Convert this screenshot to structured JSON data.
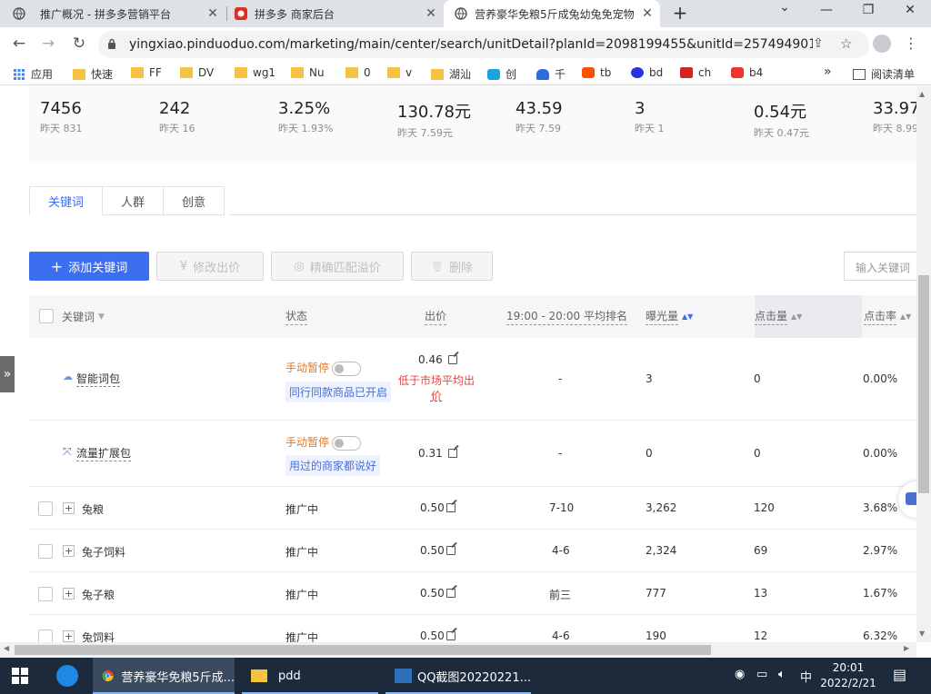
{
  "browser": {
    "tabs": [
      {
        "title": "推广概况 - 拼多多营销平台",
        "close": "✕"
      },
      {
        "title": "拼多多 商家后台",
        "close": "✕"
      },
      {
        "title": "营养豪华免粮5斤成兔幼兔免宠物兔",
        "close": "✕"
      }
    ],
    "new_tab": "+",
    "window_controls": {
      "dropdown": "⌄",
      "minimize": "—",
      "restore": "❐",
      "close": "✕"
    },
    "url": "yingxiao.pinduoduo.com/marketing/main/center/search/unitDetail?planId=2098199455&unitId=257494901...",
    "bookmarks": [
      "应用",
      "快速",
      "FF",
      "DV",
      "wg1",
      "Nu",
      "0",
      "v",
      "湖汕",
      "创",
      "千",
      "tb",
      "bd",
      "ch",
      "b4"
    ],
    "more": "»",
    "reading_list": "阅读清单"
  },
  "metrics": [
    {
      "value": "7456",
      "yesterday": "昨天 831"
    },
    {
      "value": "242",
      "yesterday": "昨天 16"
    },
    {
      "value": "3.25%",
      "yesterday": "昨天 1.93%"
    },
    {
      "value": "130.78元",
      "yesterday": "昨天 7.59元"
    },
    {
      "value": "43.59",
      "yesterday": "昨天 7.59"
    },
    {
      "value": "3",
      "yesterday": "昨天 1"
    },
    {
      "value": "0.54元",
      "yesterday": "昨天 0.47元"
    },
    {
      "value": "33.97",
      "yesterday": "昨天 8.99"
    }
  ],
  "tabs": [
    "关键词",
    "人群",
    "创意"
  ],
  "actions": {
    "add": "添加关键词",
    "add_icon": "+",
    "modify_bid": "修改出价",
    "modify_icon": "¥",
    "precise_premium": "精确匹配溢价",
    "precise_icon": "◎",
    "delete": "删除",
    "delete_icon": "🗑",
    "search_placeholder": "输入关键词"
  },
  "table": {
    "headers": {
      "keyword": "关键词",
      "filter_icon": "▼",
      "status": "状态",
      "bid": "出价",
      "rank": "19:00 - 20:00 平均排名",
      "impressions": "曝光量",
      "clicks": "点击量",
      "ctr": "点击率",
      "sort_icon": "▲▼"
    },
    "packages": [
      {
        "icon": "☁",
        "name": "智能词包",
        "status": "手动暂停",
        "tag": "同行同款商品已开启",
        "bid": "0.46",
        "warning": [
          "低于市场平均出",
          "价"
        ],
        "rank": "-",
        "impressions": "3",
        "clicks": "0",
        "ctr": "0.00%"
      },
      {
        "icon": "⤧",
        "name": "流量扩展包",
        "status": "手动暂停",
        "tag": "用过的商家都说好",
        "bid": "0.31",
        "rank": "-",
        "impressions": "0",
        "clicks": "0",
        "ctr": "0.00%"
      }
    ],
    "rows": [
      {
        "expand": "+",
        "name": "兔粮",
        "status": "推广中",
        "bid": "0.50",
        "rank": "7-10",
        "impressions": "3,262",
        "clicks": "120",
        "ctr": "3.68%"
      },
      {
        "expand": "+",
        "name": "兔子饲料",
        "status": "推广中",
        "bid": "0.50",
        "rank": "4-6",
        "impressions": "2,324",
        "clicks": "69",
        "ctr": "2.97%"
      },
      {
        "expand": "+",
        "name": "兔子粮",
        "status": "推广中",
        "bid": "0.50",
        "rank": "前三",
        "impressions": "777",
        "clicks": "13",
        "ctr": "1.67%"
      },
      {
        "expand": "+",
        "name": "兔饲料",
        "status": "推广中",
        "bid": "0.50",
        "rank": "4-6",
        "impressions": "190",
        "clicks": "12",
        "ctr": "6.32%"
      }
    ]
  },
  "side_tab": "»",
  "taskbar": {
    "apps": [
      "营养豪华免粮5斤成...",
      "pdd",
      "QQ截图20220221..."
    ],
    "tray": {
      "ime": "中",
      "time": "20:01",
      "date": "2022/2/21"
    }
  },
  "colors": {
    "primary": "#3c6ef0",
    "paused": "#e6781f",
    "warning": "#e54545",
    "tag_bg": "#eef2ff"
  }
}
